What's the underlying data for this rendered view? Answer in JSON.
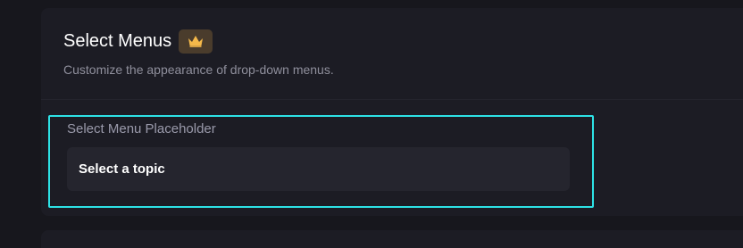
{
  "section": {
    "title": "Select Menus",
    "subtitle": "Customize the appearance of drop-down menus.",
    "badge_icon": "crown-icon",
    "badge_color": "#f5b94a"
  },
  "field": {
    "label": "Select Menu Placeholder",
    "value": "Select a topic"
  },
  "colors": {
    "background": "#17171d",
    "card": "#1c1c24",
    "input": "#25252e",
    "highlight": "#2de2e6"
  }
}
